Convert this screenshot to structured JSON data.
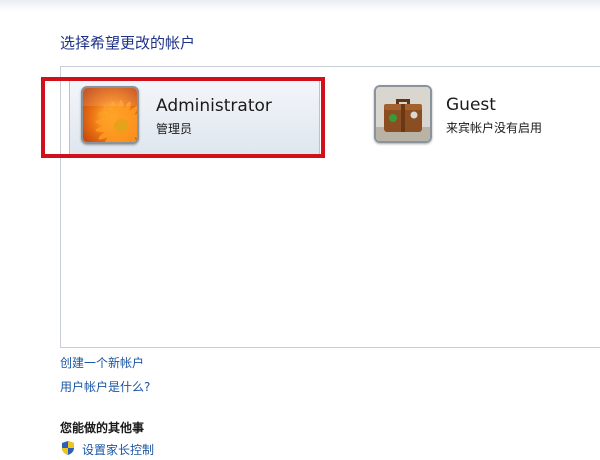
{
  "page": {
    "heading": "选择希望更改的帐户"
  },
  "accounts": [
    {
      "name": "Administrator",
      "subtitle": "管理员",
      "icon": "flower-icon",
      "selected": true
    },
    {
      "name": "Guest",
      "subtitle": "来宾帐户没有启用",
      "icon": "suitcase-icon",
      "selected": false
    }
  ],
  "links": {
    "create_account": "创建一个新帐户",
    "what_is_account": "用户帐户是什么?"
  },
  "other_tasks": {
    "title": "您能做的其他事",
    "uac_link": "设置家长控制",
    "icon": "shield-icon"
  },
  "colors": {
    "heading": "#1e3287",
    "link": "#1a55a5",
    "highlight_box": "#d0101c",
    "tile_selected": "#dfe6ee"
  }
}
